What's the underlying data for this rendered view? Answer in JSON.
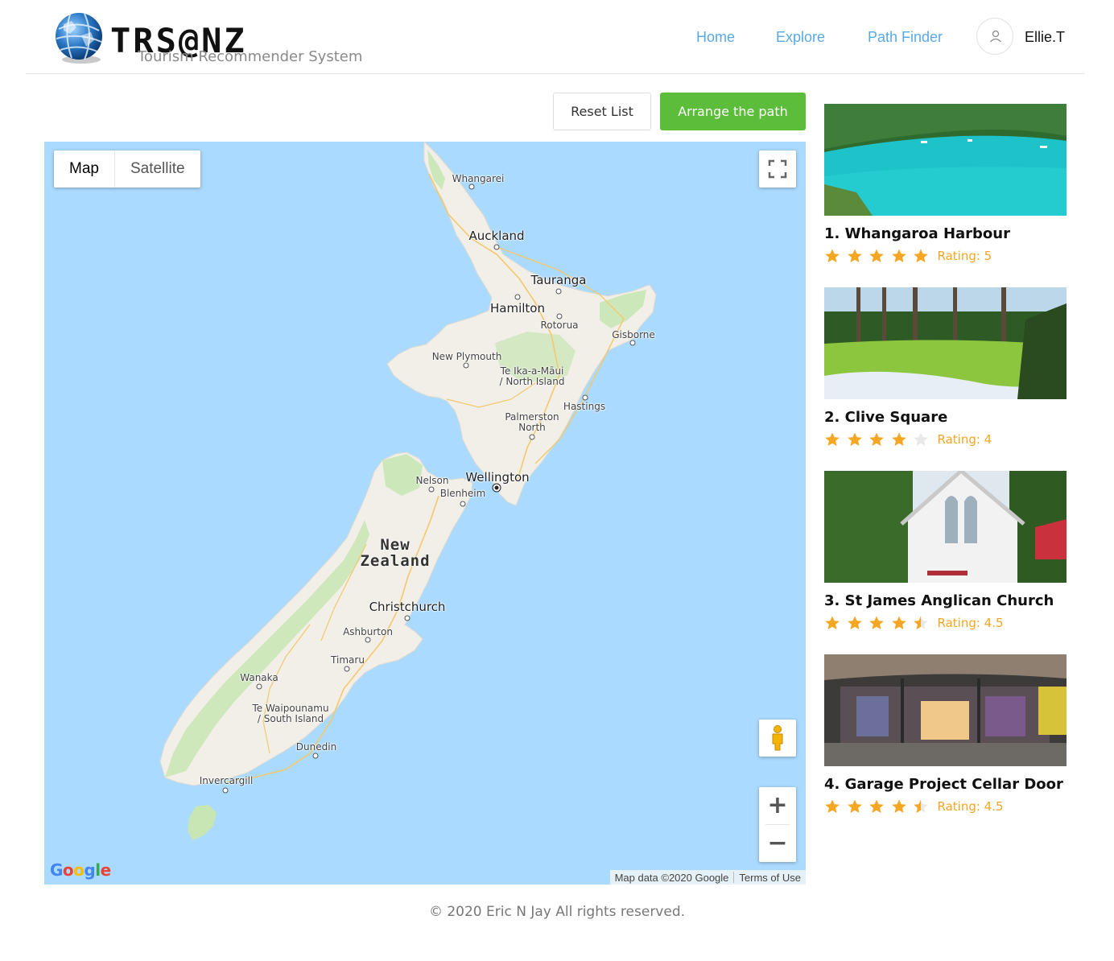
{
  "brand": {
    "title": "TRS@NZ",
    "subtitle": "Tourism Recommender System"
  },
  "nav": {
    "home": "Home",
    "explore": "Explore",
    "path_finder": "Path Finder",
    "user": "Ellie.T"
  },
  "actions": {
    "reset": "Reset List",
    "arrange": "Arrange the path"
  },
  "map": {
    "type_map": "Map",
    "type_satellite": "Satellite",
    "country": "New\nZealand",
    "cities": {
      "whangarei": "Whangarei",
      "auckland": "Auckland",
      "tauranga": "Tauranga",
      "hamilton": "Hamilton",
      "rotorua": "Rotorua",
      "gisborne": "Gisborne",
      "new_plymouth": "New Plymouth",
      "north_island": "Te Ika-a-Māui\n/ North Island",
      "hastings": "Hastings",
      "palmerston_north": "Palmerston\nNorth",
      "nelson": "Nelson",
      "wellington": "Wellington",
      "blenheim": "Blenheim",
      "christchurch": "Christchurch",
      "ashburton": "Ashburton",
      "timaru": "Timaru",
      "wanaka": "Wanaka",
      "south_island": "Te Waipounamu\n/ South Island",
      "dunedin": "Dunedin",
      "invercargill": "Invercargill"
    },
    "google_logo": "Google",
    "map_data": "Map data ©2020 Google",
    "terms": "Terms of Use",
    "zoom_in": "+",
    "zoom_out": "−",
    "colors": {
      "water": "#aadaff",
      "land": "#f2efe9",
      "park": "#c8e6b4",
      "road": "#f5c86a"
    }
  },
  "places": [
    {
      "title": "1. Whangaroa Harbour",
      "rating": 5,
      "rating_label": "Rating: 5",
      "icon": "harbour-photo"
    },
    {
      "title": "2. Clive Square",
      "rating": 4,
      "rating_label": "Rating: 4",
      "icon": "park-photo"
    },
    {
      "title": "3. St James Anglican Church",
      "rating": 4.5,
      "rating_label": "Rating: 4.5",
      "icon": "church-photo"
    },
    {
      "title": "4. Garage Project Cellar Door",
      "rating": 4.5,
      "rating_label": "Rating: 4.5",
      "icon": "cellar-door-photo"
    }
  ],
  "colors": {
    "accent_green": "#5bbd3a",
    "nav_blue": "#5aa9e6",
    "star": "#f5a623",
    "star_empty": "#e8e8e8"
  },
  "footer": "© 2020 Eric N Jay All rights reserved."
}
